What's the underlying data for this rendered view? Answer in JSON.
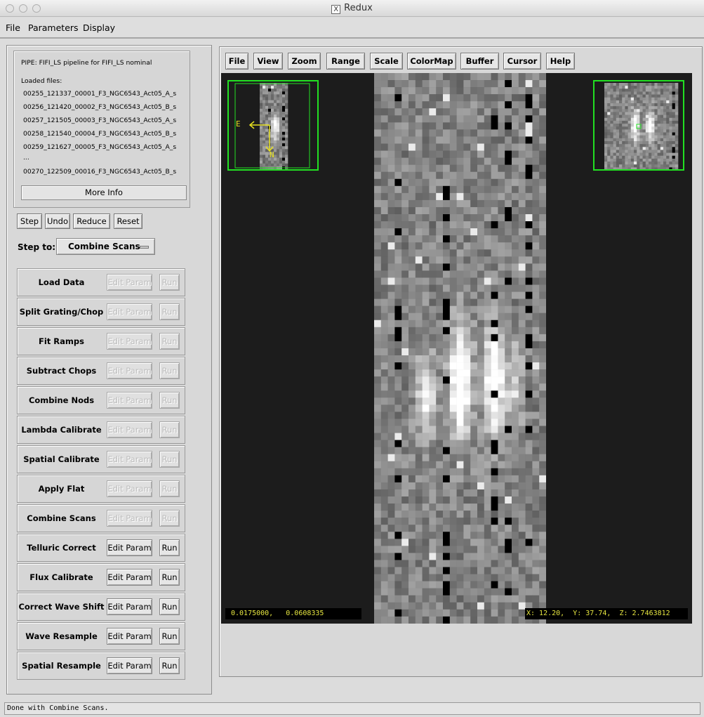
{
  "window": {
    "title": "Redux"
  },
  "menubar": [
    "File",
    "Parameters",
    "Display"
  ],
  "info": {
    "pipe": "PIPE: FIFI_LS pipeline for FIFI_LS nominal",
    "loaded_label": "Loaded files:",
    "files": [
      "00255_121337_00001_F3_NGC6543_Act05_A_s",
      "00256_121420_00002_F3_NGC6543_Act05_B_s",
      "00257_121505_00003_F3_NGC6543_Act05_A_s",
      "00258_121540_00004_F3_NGC6543_Act05_B_s",
      "00259_121627_00005_F3_NGC6543_Act05_A_s",
      "...",
      "00270_122509_00016_F3_NGC6543_Act05_B_s"
    ],
    "more_info": "More Info"
  },
  "controls": {
    "step": "Step",
    "undo": "Undo",
    "reduce": "Reduce",
    "reset": "Reset"
  },
  "stepto": {
    "label": "Step to:",
    "value": "Combine Scans"
  },
  "step_buttons": {
    "edit": "Edit Param",
    "run": "Run"
  },
  "steps": [
    {
      "name": "Load Data",
      "enabled": false
    },
    {
      "name": "Split Grating/Chop",
      "enabled": false
    },
    {
      "name": "Fit Ramps",
      "enabled": false
    },
    {
      "name": "Subtract Chops",
      "enabled": false
    },
    {
      "name": "Combine Nods",
      "enabled": false
    },
    {
      "name": "Lambda Calibrate",
      "enabled": false
    },
    {
      "name": "Spatial Calibrate",
      "enabled": false
    },
    {
      "name": "Apply Flat",
      "enabled": false
    },
    {
      "name": "Combine Scans",
      "enabled": false
    },
    {
      "name": "Telluric Correct",
      "enabled": true
    },
    {
      "name": "Flux Calibrate",
      "enabled": true
    },
    {
      "name": "Correct Wave Shift",
      "enabled": true
    },
    {
      "name": "Wave Resample",
      "enabled": true
    },
    {
      "name": "Spatial Resample",
      "enabled": true
    }
  ],
  "viewer_toolbar": [
    "File",
    "View",
    "Zoom",
    "Range",
    "Scale",
    "ColorMap",
    "Buffer",
    "Cursor",
    "Help"
  ],
  "viewer": {
    "compass_e": "E",
    "compass_n": "N",
    "coord_left": "0.0175000,   0.0608335",
    "coord_right": "X: 12.20,  Y: 37.74,  Z: 2.7463812"
  },
  "status": "Done with Combine Scans.",
  "colors": {
    "accent_green": "#22e022",
    "compass": "#e6e020",
    "readout": "#e6e640"
  }
}
